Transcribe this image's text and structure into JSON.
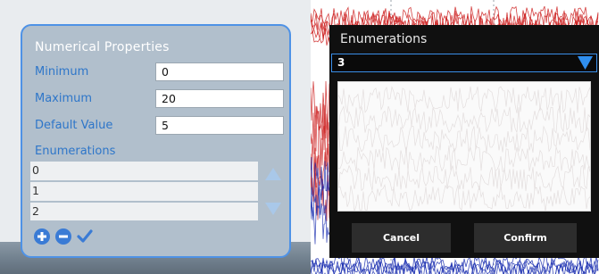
{
  "numerical_properties": {
    "title": "Numerical Properties",
    "fields": [
      {
        "label": "Minimum",
        "value": "0"
      },
      {
        "label": "Maximum",
        "value": "20"
      },
      {
        "label": "Default Value",
        "value": "5"
      }
    ],
    "enumerations_label": "Enumerations",
    "enumerations": [
      "0",
      "1",
      "2"
    ],
    "icons": {
      "scroll_up": "triangle-up-icon",
      "scroll_down": "triangle-down-icon",
      "add": "plus-circle-icon",
      "remove": "minus-circle-icon",
      "confirm": "checkmark-icon"
    }
  },
  "enumerations_dialog": {
    "title": "Enumerations",
    "selected_value": "3",
    "list_items": [],
    "cancel_label": "Cancel",
    "confirm_label": "Confirm"
  },
  "colors": {
    "accent": "#2e76c9",
    "panel_border": "#4e92e6",
    "panel_bg": "#b1bfcc",
    "dialog_bg": "#101010",
    "dropdown_arrow": "#2f8ff0",
    "waveform_red": "#cc1f1f",
    "waveform_blue": "#1b2fb0"
  }
}
